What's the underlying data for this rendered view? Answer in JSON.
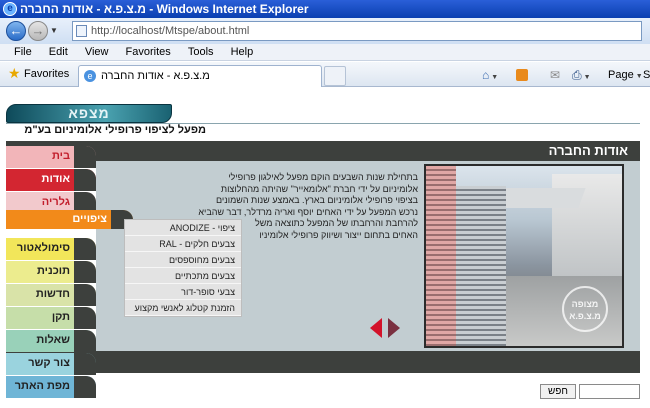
{
  "browser": {
    "title": "מ.צ.פ.א - אודות החברה - Windows Internet Explorer",
    "address": "http://localhost/Mtspe/about.html",
    "menu": [
      "File",
      "Edit",
      "View",
      "Favorites",
      "Tools",
      "Help"
    ],
    "favorites_label": "Favorites",
    "tab_title": "מ.צ.פ.א - אודות החברה",
    "page_menu": "Page",
    "safety_truncated": "S"
  },
  "site": {
    "logo_text": "מצפא",
    "tagline": "מפעל לציפוי פרופילי אלומיניום בע\"מ",
    "panel_title": "אודות החברה",
    "about_lines": [
      "בתחילת שנות השבעים הוקם מפעל לאילגון פרופילי",
      "אלומיניום על ידי חברת \"אלומאייר\" שהיתה מהחלוצות",
      "בציפוי פרופילי אלומיניום בארץ. באמצע שנות השמונים",
      "נרכש המפעל על ידי האחים יוסף ואריה מרדלר, דבר שהביא",
      "להרחבת והרחבתו של המפעל כתוצאה משל",
      "האחים בתחום ייצור ושיווק פרופילי אלומיניו"
    ],
    "photo_stamp": "מצופה מ.צ.פ.א",
    "nav": [
      "בית",
      "אודות",
      "גלריה",
      "ציפויים",
      "סימולאטור",
      "תוכנית",
      "חדשות",
      "תקן",
      "שאלות",
      "צור קשר",
      "מפת האתר"
    ],
    "submenu": [
      "ציפוי - ANODIZE",
      "צבעים חלקים - RAL",
      "צבעים מחוספסים",
      "צבעים מתכתיים",
      "צבעי סופר-דור",
      "הזמנת קטלוג לאנשי מקצוע"
    ],
    "search_button": "חפש",
    "search_value": ""
  },
  "colors": {
    "panel_dark": "#3d403d",
    "content_bg": "#c2cdd1",
    "accent_red": "#d32631",
    "accent_orange": "#f28a1a"
  }
}
